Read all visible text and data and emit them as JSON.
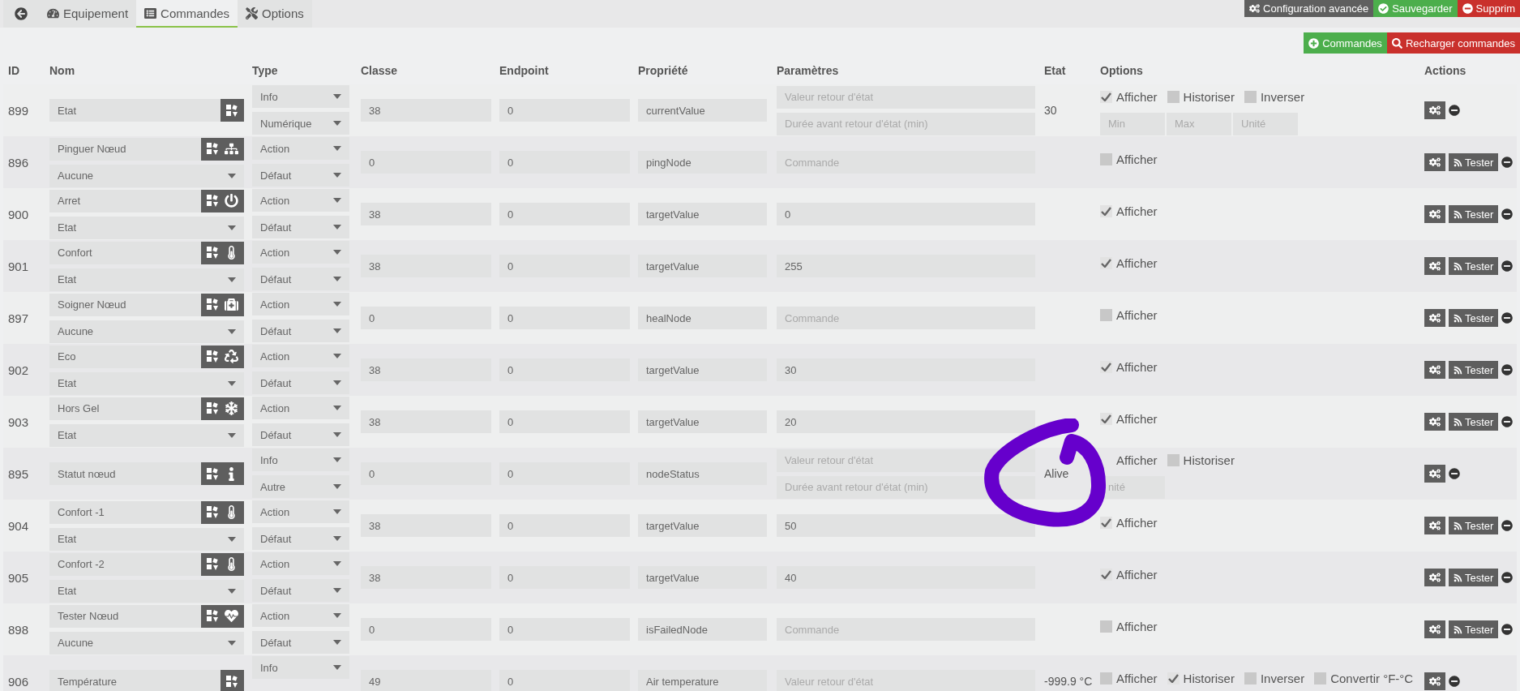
{
  "top_bar": {
    "tabs": [
      {
        "label": "Equipement",
        "selected": false
      },
      {
        "label": "Commandes",
        "selected": true
      },
      {
        "label": "Options",
        "selected": false
      }
    ],
    "buttons": [
      {
        "label": "Configuration avancée",
        "kind": "config"
      },
      {
        "label": "Sauvegarder",
        "kind": "save"
      },
      {
        "label": "Supprim",
        "kind": "delete"
      }
    ]
  },
  "toolbar": {
    "buttons": [
      {
        "label": "Commandes",
        "kind": "add"
      },
      {
        "label": "Recharger commandes",
        "kind": "reload"
      }
    ]
  },
  "table": {
    "columns": [
      "ID",
      "Nom",
      "Type",
      "Classe",
      "Endpoint",
      "Propriété",
      "Paramètres",
      "Etat",
      "Options",
      "Actions"
    ],
    "rows": [
      {
        "id": "899",
        "name": "Etat",
        "type": "Info",
        "subtype": "Numérique",
        "classe": "38",
        "endpoint": "0",
        "property": "currentValue",
        "parameters": [
          {
            "placeholder": "Valeur retour d'état"
          },
          {
            "placeholder": "Durée avant retour d'état (min)"
          }
        ],
        "state": "30",
        "options": [
          {
            "label": "Afficher",
            "checked": true
          },
          {
            "label": "Historiser",
            "checked": false
          },
          {
            "label": "Inverser",
            "checked": false
          }
        ],
        "option_fields": [
          {
            "placeholder": "Min"
          },
          {
            "placeholder": "Max"
          },
          {
            "placeholder": "Unité"
          }
        ]
      },
      {
        "id": "896",
        "name": "Pinguer Nœud",
        "link": "Aucune",
        "type": "Action",
        "subtype": "Défaut",
        "classe": "0",
        "endpoint": "0",
        "property": "pingNode",
        "parameters": [
          {
            "placeholder": "Commande"
          }
        ],
        "options": [
          {
            "label": "Afficher",
            "checked": false
          }
        ],
        "test_button": "Tester"
      },
      {
        "id": "900",
        "name": "Arret",
        "link": "Etat",
        "type": "Action",
        "subtype": "Défaut",
        "classe": "38",
        "endpoint": "0",
        "property": "targetValue",
        "parameters": [
          {
            "value": "0"
          }
        ],
        "options": [
          {
            "label": "Afficher",
            "checked": true
          }
        ],
        "test_button": "Tester"
      },
      {
        "id": "901",
        "name": "Confort",
        "link": "Etat",
        "type": "Action",
        "subtype": "Défaut",
        "classe": "38",
        "endpoint": "0",
        "property": "targetValue",
        "parameters": [
          {
            "value": "255"
          }
        ],
        "options": [
          {
            "label": "Afficher",
            "checked": true
          }
        ],
        "test_button": "Tester"
      },
      {
        "id": "897",
        "name": "Soigner Nœud",
        "link": "Aucune",
        "type": "Action",
        "subtype": "Défaut",
        "classe": "0",
        "endpoint": "0",
        "property": "healNode",
        "parameters": [
          {
            "placeholder": "Commande"
          }
        ],
        "options": [
          {
            "label": "Afficher",
            "checked": false
          }
        ],
        "test_button": "Tester"
      },
      {
        "id": "902",
        "name": "Eco",
        "link": "Etat",
        "type": "Action",
        "subtype": "Défaut",
        "classe": "38",
        "endpoint": "0",
        "property": "targetValue",
        "parameters": [
          {
            "value": "30"
          }
        ],
        "options": [
          {
            "label": "Afficher",
            "checked": true
          }
        ],
        "test_button": "Tester"
      },
      {
        "id": "903",
        "name": "Hors Gel",
        "link": "Etat",
        "type": "Action",
        "subtype": "Défaut",
        "classe": "38",
        "endpoint": "0",
        "property": "targetValue",
        "parameters": [
          {
            "value": "20"
          }
        ],
        "options": [
          {
            "label": "Afficher",
            "checked": true
          }
        ],
        "test_button": "Tester"
      },
      {
        "id": "895",
        "name": "Statut nœud",
        "type": "Info",
        "subtype": "Autre",
        "classe": "0",
        "endpoint": "0",
        "property": "nodeStatus",
        "parameters": [
          {
            "placeholder": "Valeur retour d'état"
          },
          {
            "placeholder": "Durée avant retour d'état (min)"
          }
        ],
        "state": "Alive",
        "options": [
          {
            "label": "Afficher"
          },
          {
            "label": "Historiser",
            "checked": false
          }
        ],
        "option_fields": [
          {
            "placeholder": "nité"
          }
        ]
      },
      {
        "id": "904",
        "name": "Confort -1",
        "link": "Etat",
        "type": "Action",
        "subtype": "Défaut",
        "classe": "38",
        "endpoint": "0",
        "property": "targetValue",
        "parameters": [
          {
            "value": "50"
          }
        ],
        "options": [
          {
            "label": "Afficher",
            "checked": true
          }
        ],
        "test_button": "Tester"
      },
      {
        "id": "905",
        "name": "Confort -2",
        "link": "Etat",
        "type": "Action",
        "subtype": "Défaut",
        "classe": "38",
        "endpoint": "0",
        "property": "targetValue",
        "parameters": [
          {
            "value": "40"
          }
        ],
        "options": [
          {
            "label": "Afficher",
            "checked": true
          }
        ],
        "test_button": "Tester"
      },
      {
        "id": "898",
        "name": "Tester Nœud",
        "link": "Aucune",
        "type": "Action",
        "subtype": "Défaut",
        "classe": "0",
        "endpoint": "0",
        "property": "isFailedNode",
        "parameters": [
          {
            "placeholder": "Commande"
          }
        ],
        "options": [
          {
            "label": "Afficher",
            "checked": false
          }
        ],
        "test_button": "Tester"
      },
      {
        "id": "906",
        "name": "Température",
        "type": "Info",
        "classe": "49",
        "endpoint": "0",
        "property": "Air temperature",
        "parameters": [
          {
            "placeholder": "Valeur retour d'état"
          }
        ],
        "state": "-999.9 °C",
        "options": [
          {
            "label": "Afficher",
            "checked": false
          },
          {
            "label": "Historiser",
            "checked": true
          },
          {
            "label": "Inverser",
            "checked": false
          },
          {
            "label": "Convertir °F-°C",
            "checked": false
          }
        ]
      }
    ]
  }
}
